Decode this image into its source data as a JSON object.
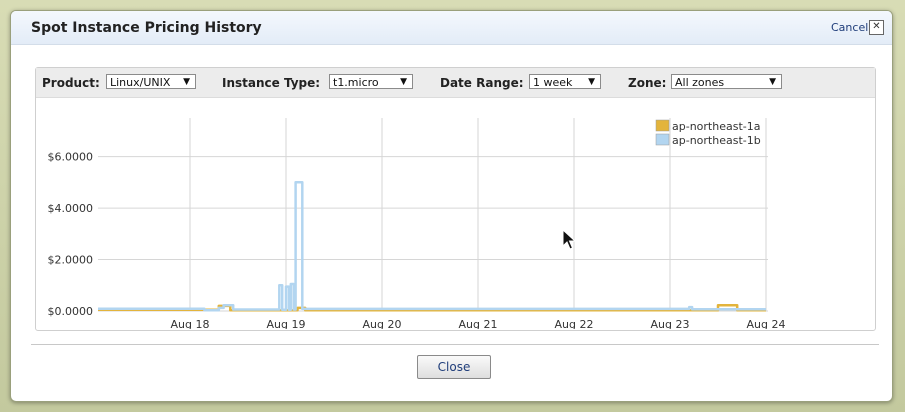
{
  "dialog": {
    "title": "Spot Instance Pricing History",
    "cancel_label": "Cancel",
    "close_x": "✕",
    "close_button_label": "Close"
  },
  "filters": {
    "product_label": "Product:",
    "product_value": "Linux/UNIX",
    "instance_type_label": "Instance Type:",
    "instance_type_value": "t1.micro",
    "date_range_label": "Date Range:",
    "date_range_value": "1 week",
    "zone_label": "Zone:",
    "zone_value": "All zones"
  },
  "colors": {
    "series_a": "#e3b43c",
    "series_b": "#b2d5f0",
    "grid": "#d6d6d6",
    "axis_text": "#333333"
  },
  "chart_data": {
    "type": "line",
    "x_ticks": [
      "Aug 18",
      "Aug 19",
      "Aug 20",
      "Aug 21",
      "Aug 22",
      "Aug 23",
      "Aug 24"
    ],
    "y_ticks": [
      "$0.0000",
      "$2.0000",
      "$4.0000",
      "$6.0000"
    ],
    "x_range": [
      17.0,
      24.0
    ],
    "ylim": [
      0,
      7.5
    ],
    "legend_position": "top-right",
    "series": [
      {
        "name": "ap-northeast-1a",
        "color": "#e3b43c",
        "points": [
          [
            17.0,
            0.05
          ],
          [
            18.3,
            0.05
          ],
          [
            18.3,
            0.2
          ],
          [
            18.42,
            0.2
          ],
          [
            18.42,
            0.03
          ],
          [
            19.12,
            0.03
          ],
          [
            19.12,
            0.12
          ],
          [
            19.2,
            0.12
          ],
          [
            19.2,
            0.03
          ],
          [
            23.5,
            0.03
          ],
          [
            23.5,
            0.22
          ],
          [
            23.7,
            0.22
          ],
          [
            23.7,
            0.03
          ],
          [
            24.0,
            0.03
          ]
        ]
      },
      {
        "name": "ap-northeast-1b",
        "color": "#b2d5f0",
        "points": [
          [
            17.0,
            0.09
          ],
          [
            18.15,
            0.09
          ],
          [
            18.15,
            0.03
          ],
          [
            18.3,
            0.03
          ],
          [
            18.3,
            0.12
          ],
          [
            18.35,
            0.12
          ],
          [
            18.35,
            0.22
          ],
          [
            18.45,
            0.22
          ],
          [
            18.45,
            0.06
          ],
          [
            18.93,
            0.06
          ],
          [
            18.93,
            1.0
          ],
          [
            18.96,
            1.0
          ],
          [
            18.96,
            0.05
          ],
          [
            19.0,
            0.05
          ],
          [
            19.0,
            0.95
          ],
          [
            19.03,
            0.95
          ],
          [
            19.03,
            0.05
          ],
          [
            19.05,
            0.05
          ],
          [
            19.05,
            1.05
          ],
          [
            19.08,
            1.05
          ],
          [
            19.08,
            0.06
          ],
          [
            19.1,
            0.06
          ],
          [
            19.1,
            5.0
          ],
          [
            19.17,
            5.0
          ],
          [
            19.17,
            0.08
          ],
          [
            23.2,
            0.08
          ],
          [
            23.2,
            0.15
          ],
          [
            23.23,
            0.15
          ],
          [
            23.23,
            0.07
          ],
          [
            24.0,
            0.07
          ]
        ]
      }
    ]
  }
}
